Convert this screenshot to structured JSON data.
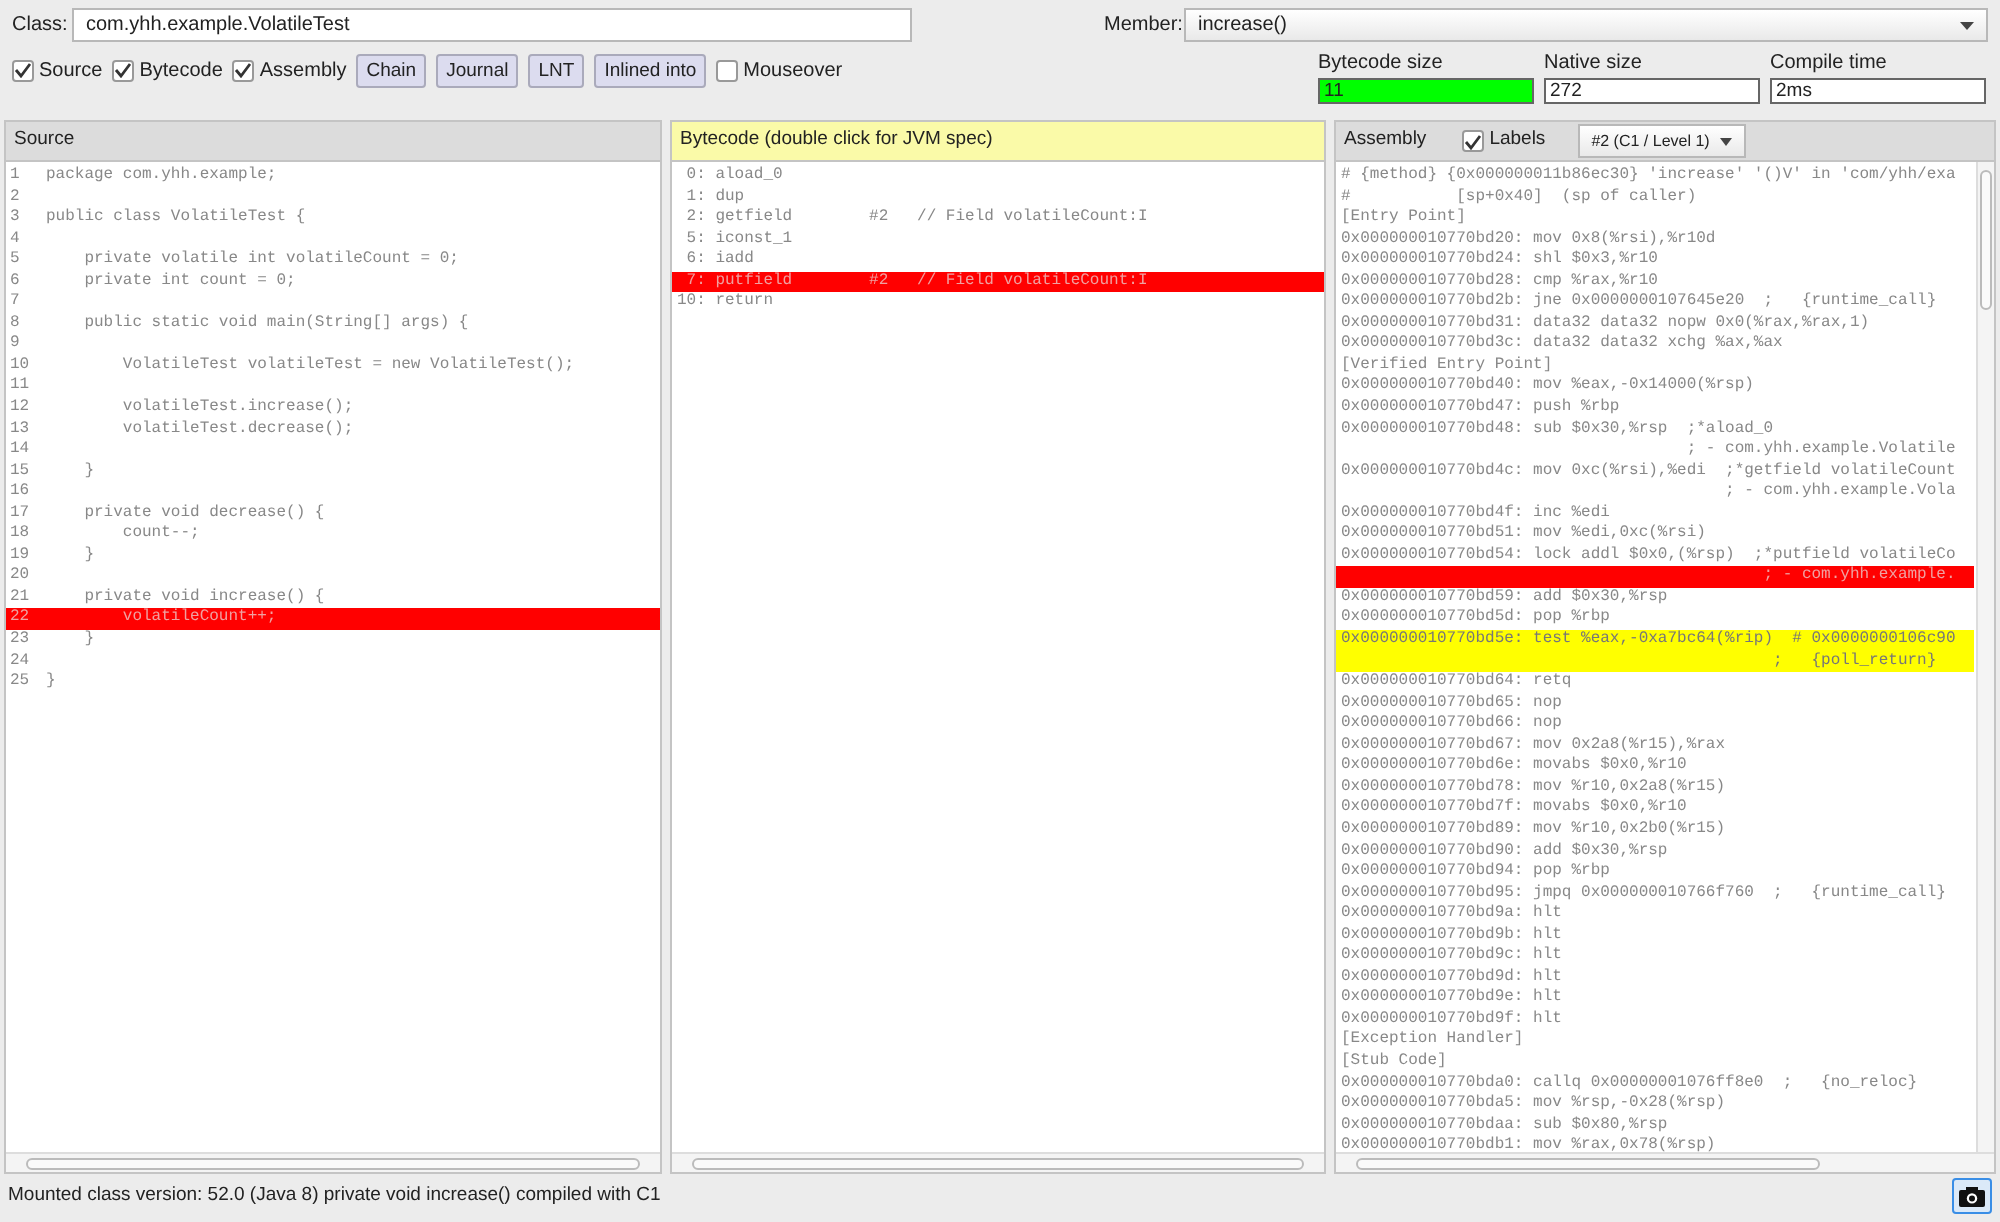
{
  "toolbar": {
    "class_label": "Class:",
    "class_value": "com.yhh.example.VolatileTest",
    "member_label": "Member:",
    "member_value": "increase()",
    "checkboxes": [
      {
        "label": "Source",
        "checked": true
      },
      {
        "label": "Bytecode",
        "checked": true
      },
      {
        "label": "Assembly",
        "checked": true
      }
    ],
    "buttons": [
      "Chain",
      "Journal",
      "LNT",
      "Inlined into"
    ],
    "mouseover": {
      "label": "Mouseover",
      "checked": false
    },
    "stats": [
      {
        "label": "Bytecode size",
        "value": "11",
        "highlighted": true
      },
      {
        "label": "Native size",
        "value": "272",
        "highlighted": false
      },
      {
        "label": "Compile time",
        "value": "2ms",
        "highlighted": false
      }
    ]
  },
  "source": {
    "title": "Source",
    "lines": [
      {
        "n": "1",
        "text": "package com.yhh.example;",
        "highlighted": false
      },
      {
        "n": "2",
        "highlighted": false
      },
      {
        "n": "3",
        "text": "public class VolatileTest {",
        "highlighted": false
      },
      {
        "n": "4",
        "highlighted": false
      },
      {
        "n": "5",
        "text": "    private volatile int volatileCount = 0;",
        "highlighted": false
      },
      {
        "n": "6",
        "text": "    private int count = 0;",
        "highlighted": false
      },
      {
        "n": "7",
        "highlighted": false
      },
      {
        "n": "8",
        "text": "    public static void main(String[] args) {",
        "highlighted": false
      },
      {
        "n": "9",
        "highlighted": false
      },
      {
        "n": "10",
        "text": "        VolatileTest volatileTest = new VolatileTest();",
        "highlighted": false
      },
      {
        "n": "11",
        "highlighted": false
      },
      {
        "n": "12",
        "text": "        volatileTest.increase();",
        "highlighted": false
      },
      {
        "n": "13",
        "text": "        volatileTest.decrease();",
        "highlighted": false
      },
      {
        "n": "14",
        "highlighted": false
      },
      {
        "n": "15",
        "text": "    }",
        "highlighted": false
      },
      {
        "n": "16",
        "highlighted": false
      },
      {
        "n": "17",
        "text": "    private void decrease() {",
        "highlighted": false
      },
      {
        "n": "18",
        "text": "        count--;",
        "highlighted": false
      },
      {
        "n": "19",
        "text": "    }",
        "highlighted": false
      },
      {
        "n": "20",
        "highlighted": false
      },
      {
        "n": "21",
        "text": "    private void increase() {",
        "highlighted": false
      },
      {
        "n": "22",
        "text": "        volatileCount++;",
        "highlighted": true
      },
      {
        "n": "23",
        "text": "    }",
        "highlighted": false
      },
      {
        "n": "24",
        "highlighted": false
      },
      {
        "n": "25",
        "text": "}",
        "highlighted": false
      }
    ]
  },
  "bytecode": {
    "title": "Bytecode (double click for JVM spec)",
    "lines": [
      {
        "text": " 0: aload_0",
        "highlighted": false
      },
      {
        "text": " 1: dup",
        "highlighted": false
      },
      {
        "text": " 2: getfield        #2   // Field volatileCount:I",
        "highlighted": false
      },
      {
        "text": " 5: iconst_1",
        "highlighted": false
      },
      {
        "text": " 6: iadd",
        "highlighted": false
      },
      {
        "text": " 7: putfield        #2   // Field volatileCount:I",
        "highlighted": true
      },
      {
        "text": "10: return",
        "highlighted": false
      }
    ]
  },
  "assembly": {
    "title": "Assembly",
    "labels": {
      "label": "Labels",
      "checked": true
    },
    "level_select": "#2  (C1 / Level 1)",
    "lines": [
      {
        "text": "# {method} {0x000000011b86ec30} 'increase' '()V' in 'com/yhh/exa",
        "highlighted": false
      },
      {
        "text": "#           [sp+0x40]  (sp of caller)",
        "highlighted": false
      },
      {
        "text": "[Entry Point]",
        "highlighted": false
      },
      {
        "text": "0x000000010770bd20: mov 0x8(%rsi),%r10d",
        "highlighted": false
      },
      {
        "text": "0x000000010770bd24: shl $0x3,%r10",
        "highlighted": false
      },
      {
        "text": "0x000000010770bd28: cmp %rax,%r10",
        "highlighted": false
      },
      {
        "text": "0x000000010770bd2b: jne 0x0000000107645e20  ;   {runtime_call}",
        "highlighted": false
      },
      {
        "text": "0x000000010770bd31: data32 data32 nopw 0x0(%rax,%rax,1)",
        "highlighted": false
      },
      {
        "text": "0x000000010770bd3c: data32 data32 xchg %ax,%ax",
        "highlighted": false
      },
      {
        "text": "[Verified Entry Point]",
        "highlighted": false
      },
      {
        "text": "0x000000010770bd40: mov %eax,-0x14000(%rsp)",
        "highlighted": false
      },
      {
        "text": "0x000000010770bd47: push %rbp",
        "highlighted": false
      },
      {
        "text": "0x000000010770bd48: sub $0x30,%rsp  ;*aload_0",
        "highlighted": false
      },
      {
        "text": "                                    ; - com.yhh.example.Volatile",
        "highlighted": false
      },
      {
        "text": "0x000000010770bd4c: mov 0xc(%rsi),%edi  ;*getfield volatileCount",
        "highlighted": false
      },
      {
        "text": "                                        ; - com.yhh.example.Vola",
        "highlighted": false
      },
      {
        "text": "0x000000010770bd4f: inc %edi",
        "highlighted": false
      },
      {
        "text": "0x000000010770bd51: mov %edi,0xc(%rsi)",
        "highlighted": false
      },
      {
        "text": "0x000000010770bd54: lock addl $0x0,(%rsp)  ;*putfield volatileCo",
        "highlighted": false
      },
      {
        "text": "                                            ; - com.yhh.example.",
        "highlighted": true,
        "color": "#ff0000"
      },
      {
        "text": "0x000000010770bd59: add $0x30,%rsp",
        "highlighted": false
      },
      {
        "text": "0x000000010770bd5d: pop %rbp",
        "highlighted": false
      },
      {
        "text": "0x000000010770bd5e: test %eax,-0xa7bc64(%rip)  # 0x0000000106c90",
        "highlighted": true,
        "color": "#ffff00"
      },
      {
        "text": "                                             ;   {poll_return}",
        "highlighted": true,
        "color": "#ffff00"
      },
      {
        "text": "0x000000010770bd64: retq",
        "highlighted": false
      },
      {
        "text": "0x000000010770bd65: nop",
        "highlighted": false
      },
      {
        "text": "0x000000010770bd66: nop",
        "highlighted": false
      },
      {
        "text": "0x000000010770bd67: mov 0x2a8(%r15),%rax",
        "highlighted": false
      },
      {
        "text": "0x000000010770bd6e: movabs $0x0,%r10",
        "highlighted": false
      },
      {
        "text": "0x000000010770bd78: mov %r10,0x2a8(%r15)",
        "highlighted": false
      },
      {
        "text": "0x000000010770bd7f: movabs $0x0,%r10",
        "highlighted": false
      },
      {
        "text": "0x000000010770bd89: mov %r10,0x2b0(%r15)",
        "highlighted": false
      },
      {
        "text": "0x000000010770bd90: add $0x30,%rsp",
        "highlighted": false
      },
      {
        "text": "0x000000010770bd94: pop %rbp",
        "highlighted": false
      },
      {
        "text": "0x000000010770bd95: jmpq 0x000000010766f760  ;   {runtime_call}",
        "highlighted": false
      },
      {
        "text": "0x000000010770bd9a: hlt",
        "highlighted": false
      },
      {
        "text": "0x000000010770bd9b: hlt",
        "highlighted": false
      },
      {
        "text": "0x000000010770bd9c: hlt",
        "highlighted": false
      },
      {
        "text": "0x000000010770bd9d: hlt",
        "highlighted": false
      },
      {
        "text": "0x000000010770bd9e: hlt",
        "highlighted": false
      },
      {
        "text": "0x000000010770bd9f: hlt",
        "highlighted": false
      },
      {
        "text": "[Exception Handler]",
        "highlighted": false
      },
      {
        "text": "[Stub Code]",
        "highlighted": false
      },
      {
        "text": "0x000000010770bda0: callq 0x00000001076ff8e0  ;   {no_reloc}",
        "highlighted": false
      },
      {
        "text": "0x000000010770bda5: mov %rsp,-0x28(%rsp)",
        "highlighted": false
      },
      {
        "text": "0x000000010770bdaa: sub $0x80,%rsp",
        "highlighted": false
      },
      {
        "text": "0x000000010770bdb1: mov %rax,0x78(%rsp)",
        "highlighted": false
      }
    ]
  },
  "status_bar": {
    "text": "Mounted class version: 52.0 (Java 8) private void increase() compiled with C1"
  }
}
